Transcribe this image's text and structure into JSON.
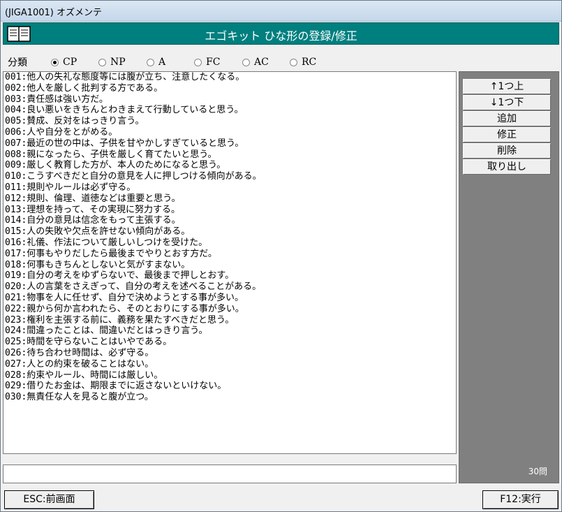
{
  "window": {
    "title": "(JIGA1001)  オズメンテ"
  },
  "header": {
    "title": "エゴキット  ひな形の登録/修正",
    "book_icon": "book-icon"
  },
  "category": {
    "label": "分類",
    "options": [
      {
        "label": "CP",
        "selected": true
      },
      {
        "label": "NP",
        "selected": false
      },
      {
        "label": "A",
        "selected": false
      },
      {
        "label": "FC",
        "selected": false
      },
      {
        "label": "AC",
        "selected": false
      },
      {
        "label": "RC",
        "selected": false
      }
    ]
  },
  "questions": [
    "001:他人の失礼な態度等には腹が立ち、注意したくなる。",
    "002:他人を厳しく批判する方である。",
    "003:責任感は強い方だ。",
    "004:良い悪いをきちんとわきまえて行動していると思う。",
    "005:賛成、反対をはっきり言う。",
    "006:人や自分をとがめる。",
    "007:最近の世の中は、子供を甘やかしすぎていると思う。",
    "008:親になったら、子供を厳しく育てたいと思う。",
    "009:厳しく教育した方が、本人のためになると思う。",
    "010:こうすべきだと自分の意見を人に押しつける傾向がある。",
    "011:規則やルールは必ず守る。",
    "012:規則、倫理、道徳などは重要と思う。",
    "013:理想を持って、その実現に努力する。",
    "014:自分の意見は信念をもって主張する。",
    "015:人の失敗や欠点を許せない傾向がある。",
    "016:礼儀、作法について厳しいしつけを受けた。",
    "017:何事もやりだしたら最後までやりとおす方だ。",
    "018:何事もきちんとしないと気がすまない。",
    "019:自分の考えをゆずらないで、最後まで押しとおす。",
    "020:人の言葉をさえぎって、自分の考えを述べることがある。",
    "021:物事を人に任せず、自分で決めようとする事が多い。",
    "022:親から何か言われたら、そのとおりにする事が多い。",
    "023:権利を主張する前に、義務を果たすべきだと思う。",
    "024:間違ったことは、間違いだとはっきり言う。",
    "025:時間を守らないことはいやである。",
    "026:待ち合わせ時間は、必ず守る。",
    "027:人との約束を破ることはない。",
    "028:約束やルール、時間には厳しい。",
    "029:借りたお金は、期限までに返さないといけない。",
    "030:無責任な人を見ると腹が立つ。"
  ],
  "input": {
    "value": ""
  },
  "side_buttons": {
    "up": "↑1つ上",
    "down": "↓1つ下",
    "add": "追加",
    "edit": "修正",
    "delete": "削除",
    "retrieve": "取り出し"
  },
  "count_label": "30問",
  "footer": {
    "esc": "ESC:前画面",
    "f12": "F12:実行"
  },
  "colors": {
    "header_bg": "#007f7f",
    "panel_bg": "#808080"
  }
}
